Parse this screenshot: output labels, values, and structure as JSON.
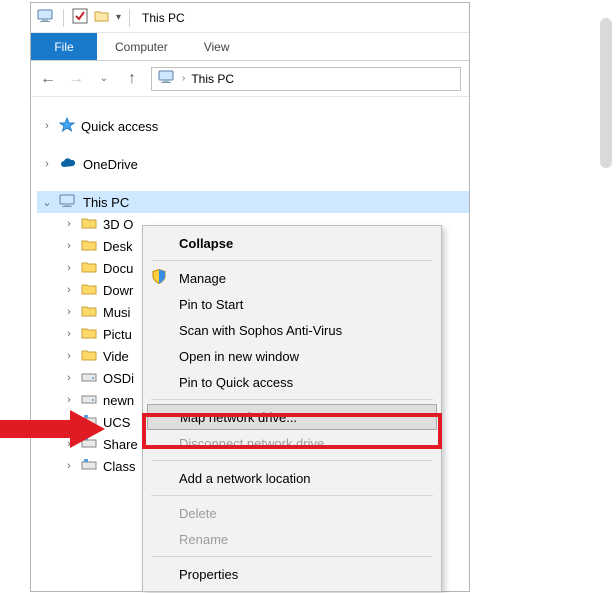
{
  "titlebar": {
    "app_title": "This PC"
  },
  "ribbon": {
    "file": "File",
    "tabs": [
      "Computer",
      "View"
    ]
  },
  "nav": {
    "breadcrumb_root": "This PC"
  },
  "tree": {
    "quick_access": "Quick access",
    "onedrive": "OneDrive",
    "this_pc": "This PC",
    "children": [
      "3D O",
      "Desk",
      "Docu",
      "Dowr",
      "Musi",
      "Pictu",
      "Vide",
      "OSDi",
      "newn",
      "UCS",
      "Share",
      "Class"
    ]
  },
  "context_menu": {
    "collapse": "Collapse",
    "manage": "Manage",
    "pin_start": "Pin to Start",
    "scan_sophos": "Scan with Sophos Anti-Virus",
    "open_new_window": "Open in new window",
    "pin_quick_access": "Pin to Quick access",
    "map_network_drive": "Map network drive...",
    "disconnect_network_drive": "Disconnect network drive...",
    "add_network_location": "Add a network location",
    "delete": "Delete",
    "rename": "Rename",
    "properties": "Properties"
  }
}
